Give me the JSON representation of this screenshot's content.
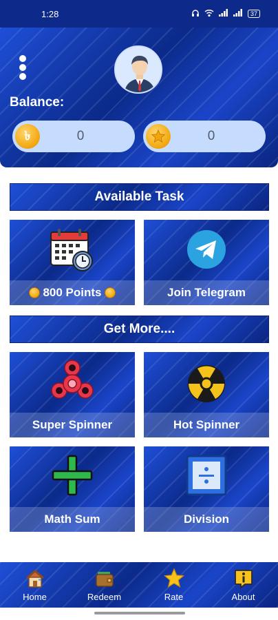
{
  "status_bar": {
    "time": "1:28",
    "battery": "37"
  },
  "header": {
    "balance_label": "Balance:",
    "balances": [
      {
        "icon": "taka-coin-icon",
        "value": "0"
      },
      {
        "icon": "star-coin-icon",
        "value": "0"
      }
    ]
  },
  "sections": {
    "available_task": "Available Task",
    "get_more": "Get More...."
  },
  "tasks": [
    {
      "label": "800 Points",
      "icon": "calendar-clock-icon"
    },
    {
      "label": "Join Telegram",
      "icon": "telegram-icon"
    }
  ],
  "games": [
    {
      "label": "Super Spinner",
      "icon": "fidget-spinner-red-icon"
    },
    {
      "label": "Hot Spinner",
      "icon": "fidget-spinner-yellow-icon"
    },
    {
      "label": "Math Sum",
      "icon": "plus-icon"
    },
    {
      "label": "Division",
      "icon": "division-icon"
    }
  ],
  "bottom_nav": [
    {
      "label": "Home",
      "icon": "home-icon"
    },
    {
      "label": "Redeem",
      "icon": "wallet-icon"
    },
    {
      "label": "Rate",
      "icon": "star-icon"
    },
    {
      "label": "About",
      "icon": "info-icon"
    }
  ],
  "colors": {
    "primary": "#0d2f9e",
    "pill": "#c5dcff",
    "coin": "#f2a50c"
  }
}
